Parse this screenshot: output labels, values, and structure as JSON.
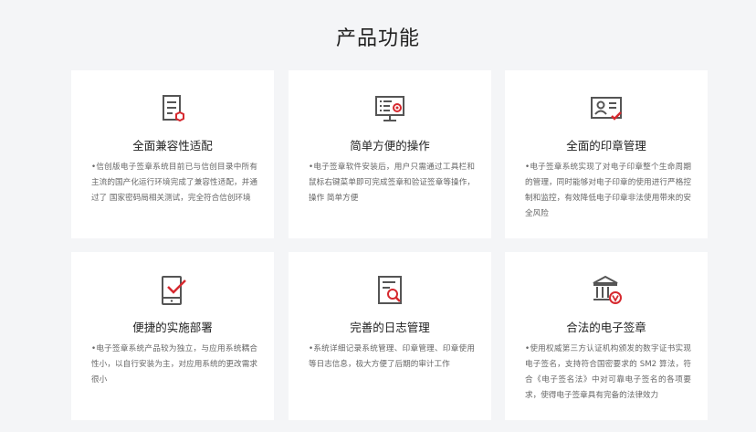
{
  "page_title": "产品功能",
  "colors": {
    "accent": "#d6292f",
    "icon_stroke": "#555555"
  },
  "features": [
    {
      "icon": "document-badge-icon",
      "title": "全面兼容性适配",
      "desc": "•信创版电子签章系统目前已与信创目录中所有主流的国产化运行环境完成了兼容性适配，并通过了 国家密码局相关测试，完全符合信创环境"
    },
    {
      "icon": "monitor-seal-icon",
      "title": "简单方便的操作",
      "desc": "•电子签章软件安装后，用户只需通过工具栏和鼠标右键菜单即可完成签章和验证签章等操作，操作 简单方便"
    },
    {
      "icon": "id-card-check-icon",
      "title": "全面的印章管理",
      "desc": "•电子签章系统实现了对电子印章整个生命周期的管理，同时能够对电子印章的使用进行严格控制和监控，有效降低电子印章非法使用带来的安全风险"
    },
    {
      "icon": "tablet-check-icon",
      "title": "便捷的实施部署",
      "desc": "•电子签章系统产品较为独立，与应用系统耦合性小，以自行安装为主，对应用系统的更改需求很小"
    },
    {
      "icon": "log-search-icon",
      "title": "完善的日志管理",
      "desc": "•系统详细记录系统管理、印章管理、印章使用 等日志信息，极大方便了后期的审计工作"
    },
    {
      "icon": "bank-verified-icon",
      "title": "合法的电子签章",
      "desc": "•使用权威第三方认证机构颁发的数字证书实现电子签名，支持符合国密要求的 SM2 算法，符合《电子签名法》中对可靠电子签名的各项要求，使得电子签章具有完备的法律效力"
    }
  ]
}
